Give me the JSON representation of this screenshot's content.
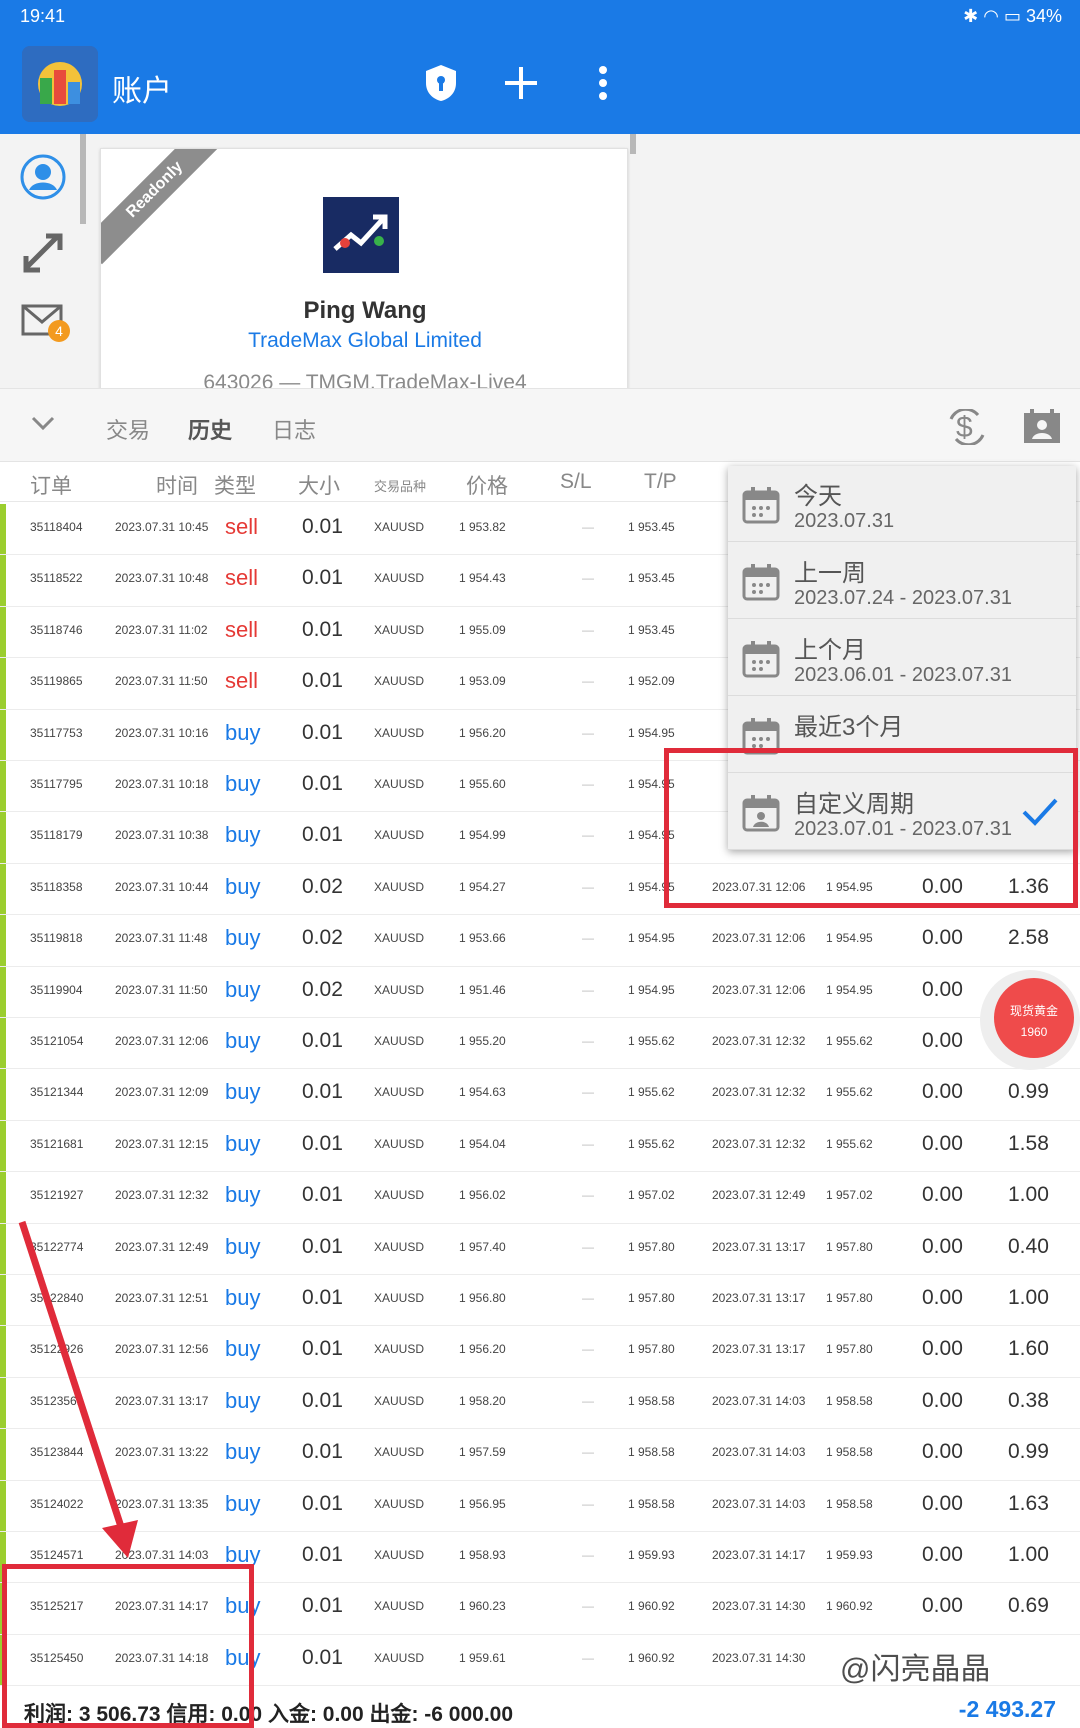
{
  "status": {
    "time": "19:41",
    "battery": "34%"
  },
  "header": {
    "title": "账户"
  },
  "account": {
    "ribbon": "Readonly",
    "name": "Ping Wang",
    "broker": "TradeMax Global Limited",
    "server": "643026 — TMGM.TradeMax-Live4"
  },
  "nav": {
    "mail_badge": "4"
  },
  "tabs": [
    "交易",
    "历史",
    "日志"
  ],
  "columns": {
    "order": "订单",
    "time": "时间",
    "type": "类型",
    "size": "大小",
    "symbol": "交易品种",
    "price": "价格",
    "sl": "S/L",
    "tp": "T/P"
  },
  "rows": [
    {
      "o": "35118404",
      "t": "2023.07.31 10:45",
      "ty": "sell",
      "s": "0.01",
      "sym": "XAUUSD",
      "p": "1 953.82",
      "tp": "1 953.45",
      "ct": "",
      "cp": "",
      "sw": "",
      "pr": ""
    },
    {
      "o": "35118522",
      "t": "2023.07.31 10:48",
      "ty": "sell",
      "s": "0.01",
      "sym": "XAUUSD",
      "p": "1 954.43",
      "tp": "1 953.45",
      "ct": "",
      "cp": "",
      "sw": "",
      "pr": ""
    },
    {
      "o": "35118746",
      "t": "2023.07.31 11:02",
      "ty": "sell",
      "s": "0.01",
      "sym": "XAUUSD",
      "p": "1 955.09",
      "tp": "1 953.45",
      "ct": "",
      "cp": "",
      "sw": "",
      "pr": ""
    },
    {
      "o": "35119865",
      "t": "2023.07.31 11:50",
      "ty": "sell",
      "s": "0.01",
      "sym": "XAUUSD",
      "p": "1 953.09",
      "tp": "1 952.09",
      "ct": "",
      "cp": "",
      "sw": "",
      "pr": ""
    },
    {
      "o": "35117753",
      "t": "2023.07.31 10:16",
      "ty": "buy",
      "s": "0.01",
      "sym": "XAUUSD",
      "p": "1 956.20",
      "tp": "1 954.95",
      "ct": "",
      "cp": "",
      "sw": "",
      "pr": ""
    },
    {
      "o": "35117795",
      "t": "2023.07.31 10:18",
      "ty": "buy",
      "s": "0.01",
      "sym": "XAUUSD",
      "p": "1 955.60",
      "tp": "1 954.95",
      "ct": "",
      "cp": "",
      "sw": "",
      "pr": ""
    },
    {
      "o": "35118179",
      "t": "2023.07.31 10:38",
      "ty": "buy",
      "s": "0.01",
      "sym": "XAUUSD",
      "p": "1 954.99",
      "tp": "1 954.95",
      "ct": "",
      "cp": "",
      "sw": "",
      "pr": ""
    },
    {
      "o": "35118358",
      "t": "2023.07.31 10:44",
      "ty": "buy",
      "s": "0.02",
      "sym": "XAUUSD",
      "p": "1 954.27",
      "tp": "1 954.95",
      "ct": "2023.07.31 12:06",
      "cp": "1 954.95",
      "sw": "0.00",
      "pr": "1.36"
    },
    {
      "o": "35119818",
      "t": "2023.07.31 11:48",
      "ty": "buy",
      "s": "0.02",
      "sym": "XAUUSD",
      "p": "1 953.66",
      "tp": "1 954.95",
      "ct": "2023.07.31 12:06",
      "cp": "1 954.95",
      "sw": "0.00",
      "pr": "2.58"
    },
    {
      "o": "35119904",
      "t": "2023.07.31 11:50",
      "ty": "buy",
      "s": "0.02",
      "sym": "XAUUSD",
      "p": "1 951.46",
      "tp": "1 954.95",
      "ct": "2023.07.31 12:06",
      "cp": "1 954.95",
      "sw": "0.00",
      "pr": ""
    },
    {
      "o": "35121054",
      "t": "2023.07.31 12:06",
      "ty": "buy",
      "s": "0.01",
      "sym": "XAUUSD",
      "p": "1 955.20",
      "tp": "1 955.62",
      "ct": "2023.07.31 12:32",
      "cp": "1 955.62",
      "sw": "0.00",
      "pr": ""
    },
    {
      "o": "35121344",
      "t": "2023.07.31 12:09",
      "ty": "buy",
      "s": "0.01",
      "sym": "XAUUSD",
      "p": "1 954.63",
      "tp": "1 955.62",
      "ct": "2023.07.31 12:32",
      "cp": "1 955.62",
      "sw": "0.00",
      "pr": "0.99"
    },
    {
      "o": "35121681",
      "t": "2023.07.31 12:15",
      "ty": "buy",
      "s": "0.01",
      "sym": "XAUUSD",
      "p": "1 954.04",
      "tp": "1 955.62",
      "ct": "2023.07.31 12:32",
      "cp": "1 955.62",
      "sw": "0.00",
      "pr": "1.58"
    },
    {
      "o": "35121927",
      "t": "2023.07.31 12:32",
      "ty": "buy",
      "s": "0.01",
      "sym": "XAUUSD",
      "p": "1 956.02",
      "tp": "1 957.02",
      "ct": "2023.07.31 12:49",
      "cp": "1 957.02",
      "sw": "0.00",
      "pr": "1.00"
    },
    {
      "o": "35122774",
      "t": "2023.07.31 12:49",
      "ty": "buy",
      "s": "0.01",
      "sym": "XAUUSD",
      "p": "1 957.40",
      "tp": "1 957.80",
      "ct": "2023.07.31 13:17",
      "cp": "1 957.80",
      "sw": "0.00",
      "pr": "0.40"
    },
    {
      "o": "35122840",
      "t": "2023.07.31 12:51",
      "ty": "buy",
      "s": "0.01",
      "sym": "XAUUSD",
      "p": "1 956.80",
      "tp": "1 957.80",
      "ct": "2023.07.31 13:17",
      "cp": "1 957.80",
      "sw": "0.00",
      "pr": "1.00"
    },
    {
      "o": "35122926",
      "t": "2023.07.31 12:56",
      "ty": "buy",
      "s": "0.01",
      "sym": "XAUUSD",
      "p": "1 956.20",
      "tp": "1 957.80",
      "ct": "2023.07.31 13:17",
      "cp": "1 957.80",
      "sw": "0.00",
      "pr": "1.60"
    },
    {
      "o": "35123561",
      "t": "2023.07.31 13:17",
      "ty": "buy",
      "s": "0.01",
      "sym": "XAUUSD",
      "p": "1 958.20",
      "tp": "1 958.58",
      "ct": "2023.07.31 14:03",
      "cp": "1 958.58",
      "sw": "0.00",
      "pr": "0.38"
    },
    {
      "o": "35123844",
      "t": "2023.07.31 13:22",
      "ty": "buy",
      "s": "0.01",
      "sym": "XAUUSD",
      "p": "1 957.59",
      "tp": "1 958.58",
      "ct": "2023.07.31 14:03",
      "cp": "1 958.58",
      "sw": "0.00",
      "pr": "0.99"
    },
    {
      "o": "35124022",
      "t": "2023.07.31 13:35",
      "ty": "buy",
      "s": "0.01",
      "sym": "XAUUSD",
      "p": "1 956.95",
      "tp": "1 958.58",
      "ct": "2023.07.31 14:03",
      "cp": "1 958.58",
      "sw": "0.00",
      "pr": "1.63"
    },
    {
      "o": "35124571",
      "t": "2023.07.31 14:03",
      "ty": "buy",
      "s": "0.01",
      "sym": "XAUUSD",
      "p": "1 958.93",
      "tp": "1 959.93",
      "ct": "2023.07.31 14:17",
      "cp": "1 959.93",
      "sw": "0.00",
      "pr": "1.00"
    },
    {
      "o": "35125217",
      "t": "2023.07.31 14:17",
      "ty": "buy",
      "s": "0.01",
      "sym": "XAUUSD",
      "p": "1 960.23",
      "tp": "1 960.92",
      "ct": "2023.07.31 14:30",
      "cp": "1 960.92",
      "sw": "0.00",
      "pr": "0.69"
    },
    {
      "o": "35125450",
      "t": "2023.07.31 14:18",
      "ty": "buy",
      "s": "0.01",
      "sym": "XAUUSD",
      "p": "1 959.61",
      "tp": "1 960.92",
      "ct": "2023.07.31 14:30",
      "cp": "",
      "sw": "",
      "pr": ""
    }
  ],
  "dropdown": [
    {
      "label": "今天",
      "range": "2023.07.31",
      "selected": false
    },
    {
      "label": "上一周",
      "range": "2023.07.24 - 2023.07.31",
      "selected": false
    },
    {
      "label": "上个月",
      "range": "2023.06.01 - 2023.07.31",
      "selected": false
    },
    {
      "label": "最近3个月",
      "range": "",
      "selected": false
    },
    {
      "label": "自定义周期",
      "range": "2023.07.01 - 2023.07.31",
      "selected": true
    }
  ],
  "fab": {
    "line1": "现货黄金",
    "line2": "1960"
  },
  "footer": {
    "summary": "利润: 3 506.73  信用: 0.00  入金: 0.00  出金: -6 000.00",
    "total": "-2 493.27"
  },
  "watermark": "@闪亮晶晶",
  "colors": {
    "primary": "#1a7ae6",
    "sell": "#e53935",
    "buy": "#1a7ae6",
    "annotation": "#e02b3a",
    "row_bar": "#9bce2e"
  }
}
